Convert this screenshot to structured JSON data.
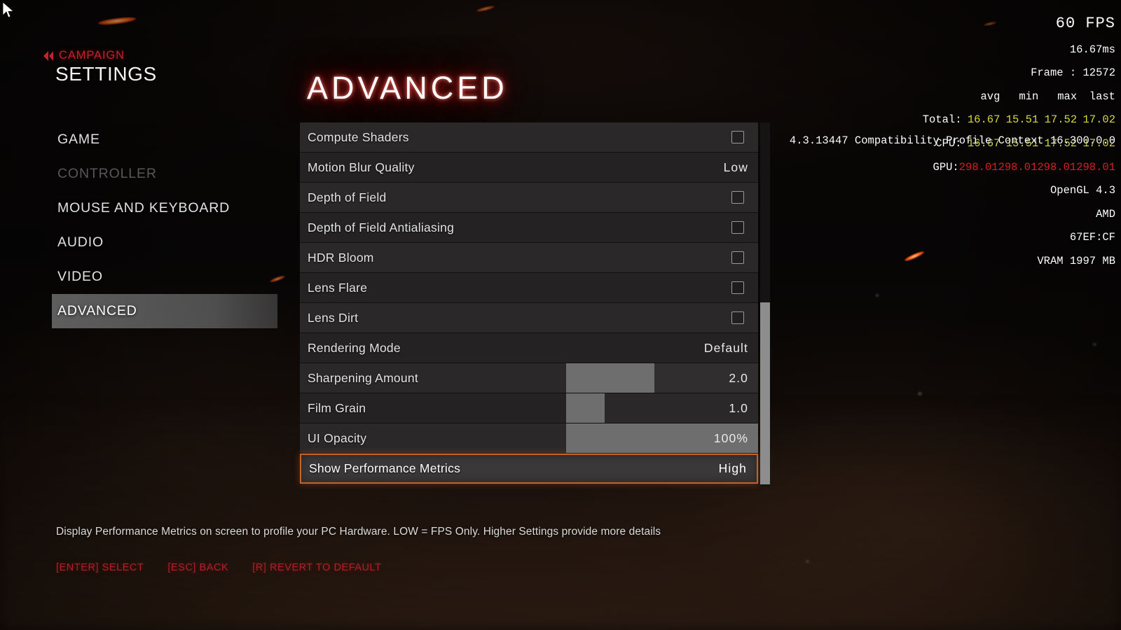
{
  "header": {
    "back_label": "CAMPAIGN",
    "back_icon": "double-chevron-left-icon",
    "title": "SETTINGS"
  },
  "page_title": "ADVANCED",
  "sidebar": {
    "items": [
      {
        "label": "GAME",
        "state": "normal"
      },
      {
        "label": "CONTROLLER",
        "state": "disabled"
      },
      {
        "label": "MOUSE AND KEYBOARD",
        "state": "normal"
      },
      {
        "label": "AUDIO",
        "state": "normal"
      },
      {
        "label": "VIDEO",
        "state": "normal"
      },
      {
        "label": "ADVANCED",
        "state": "active"
      }
    ]
  },
  "settings": {
    "rows": [
      {
        "label": "Compute Shaders",
        "type": "checkbox",
        "value": "",
        "checked": false
      },
      {
        "label": "Motion Blur Quality",
        "type": "value",
        "value": "Low"
      },
      {
        "label": "Depth of Field",
        "type": "checkbox",
        "value": "",
        "checked": false
      },
      {
        "label": "Depth of Field Antialiasing",
        "type": "checkbox",
        "value": "",
        "checked": false
      },
      {
        "label": "HDR Bloom",
        "type": "checkbox",
        "value": "",
        "checked": false
      },
      {
        "label": "Lens Flare",
        "type": "checkbox",
        "value": "",
        "checked": false
      },
      {
        "label": "Lens Dirt",
        "type": "checkbox",
        "value": "",
        "checked": false
      },
      {
        "label": "Rendering Mode",
        "type": "value",
        "value": "Default"
      },
      {
        "label": "Sharpening Amount",
        "type": "slider",
        "value": "2.0",
        "fill_percent": 46
      },
      {
        "label": "Film Grain",
        "type": "slider",
        "value": "1.0",
        "fill_percent": 20
      },
      {
        "label": "UI Opacity",
        "type": "slider",
        "value": "100%",
        "fill_percent": 100
      },
      {
        "label": "Show Performance Metrics",
        "type": "value",
        "value": "High",
        "selected": true
      }
    ]
  },
  "description": "Display Performance Metrics on screen to profile your PC Hardware.  LOW = FPS Only. Higher Settings provide more details",
  "hints": [
    "[ENTER] SELECT",
    "[ESC] BACK",
    "[R] REVERT TO DEFAULT"
  ],
  "perf_overlay": {
    "fps": "60 FPS",
    "frametime": "16.67ms",
    "frame": "Frame : 12572",
    "col_headers": {
      "avg": "avg",
      "min": "min",
      "max": "max",
      "last": "last"
    },
    "total": {
      "label": "Total:",
      "avg": "16.67",
      "min": "15.51",
      "max": "17.52",
      "last": "17.02"
    },
    "cpu": {
      "label": "CPU:",
      "avg": "16.67",
      "min": "15.51",
      "max": "17.52",
      "last": "17.02"
    },
    "gpu": {
      "label": "GPU:",
      "avg": "298.01",
      "min": "298.01",
      "max": "298.01",
      "last": "298.01"
    },
    "api": "OpenGL 4.3",
    "vendor": "AMD",
    "device_id": "67EF:CF",
    "vram": "VRAM 1997 MB",
    "driver_context": "4.3.13447 Compatibility Profile Context 16.300.0.0"
  },
  "colors": {
    "accent_red": "#c4222c",
    "selection_orange": "#c4642a",
    "perf_yellow": "#d8d83a",
    "perf_red": "#d92020",
    "row_bg": "#2a2829",
    "row_bg_alt": "#242223",
    "slider_fill": "#6e6e6e"
  }
}
